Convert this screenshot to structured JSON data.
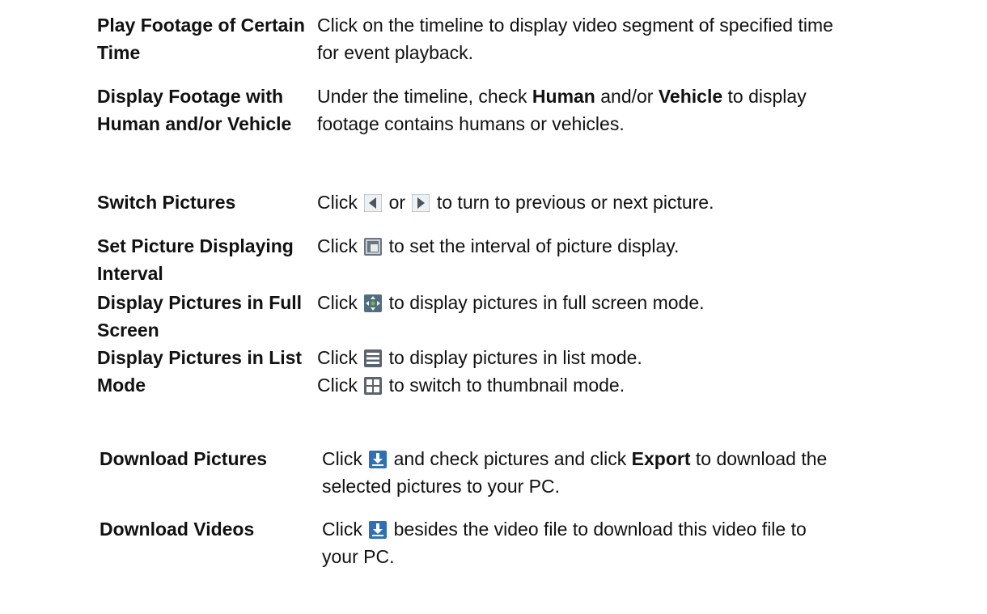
{
  "rows": [
    {
      "term": [
        "Play Footage of Certain",
        "Time"
      ],
      "desc_line1": "Click on the timeline to display video segment of specified time",
      "desc_line2": "for event playback."
    },
    {
      "term": [
        "Display Footage with",
        "Human and/or Vehicle"
      ],
      "l1_pre": "Under the timeline, check ",
      "l1_b1": "Human",
      "l1_mid": " and/or ",
      "l1_b2": "Vehicle",
      "l1_post": " to display",
      "desc_line2": "footage contains humans or vehicles."
    },
    {
      "term": [
        "Switch Pictures"
      ],
      "pre": "Click ",
      "mid": " or ",
      "post": " to turn to previous or next picture."
    },
    {
      "term": [
        "Set Picture Displaying",
        "Interval"
      ],
      "pre": "Click ",
      "post": " to set the interval of picture display."
    },
    {
      "term": [
        "Display Pictures in Full",
        "Screen"
      ],
      "pre": "Click ",
      "post": " to display pictures in full screen mode."
    },
    {
      "term": [
        "Display Pictures in List",
        "Mode"
      ],
      "pre1": "Click ",
      "post1": " to display pictures in list mode.",
      "pre2": "Click ",
      "post2": " to switch to thumbnail mode."
    },
    {
      "term": [
        "Download Pictures"
      ],
      "pre": "Click ",
      "mid": " and check pictures and click ",
      "bold": "Export",
      "post": " to download the",
      "desc_line2": "selected pictures to your PC."
    },
    {
      "term": [
        "Download Videos"
      ],
      "pre": "Click ",
      "post": " besides the video file to download this video file to",
      "desc_line2": "your PC."
    }
  ],
  "icons": {
    "prev": "previous-picture-icon",
    "next": "next-picture-icon",
    "interval": "interval-icon",
    "fullscreen": "full-screen-icon",
    "list": "list-mode-icon",
    "thumbnail": "thumbnail-mode-icon",
    "download": "download-icon"
  },
  "colors": {
    "icon_blue": "#2f6fb3",
    "icon_gray": "#555555"
  }
}
